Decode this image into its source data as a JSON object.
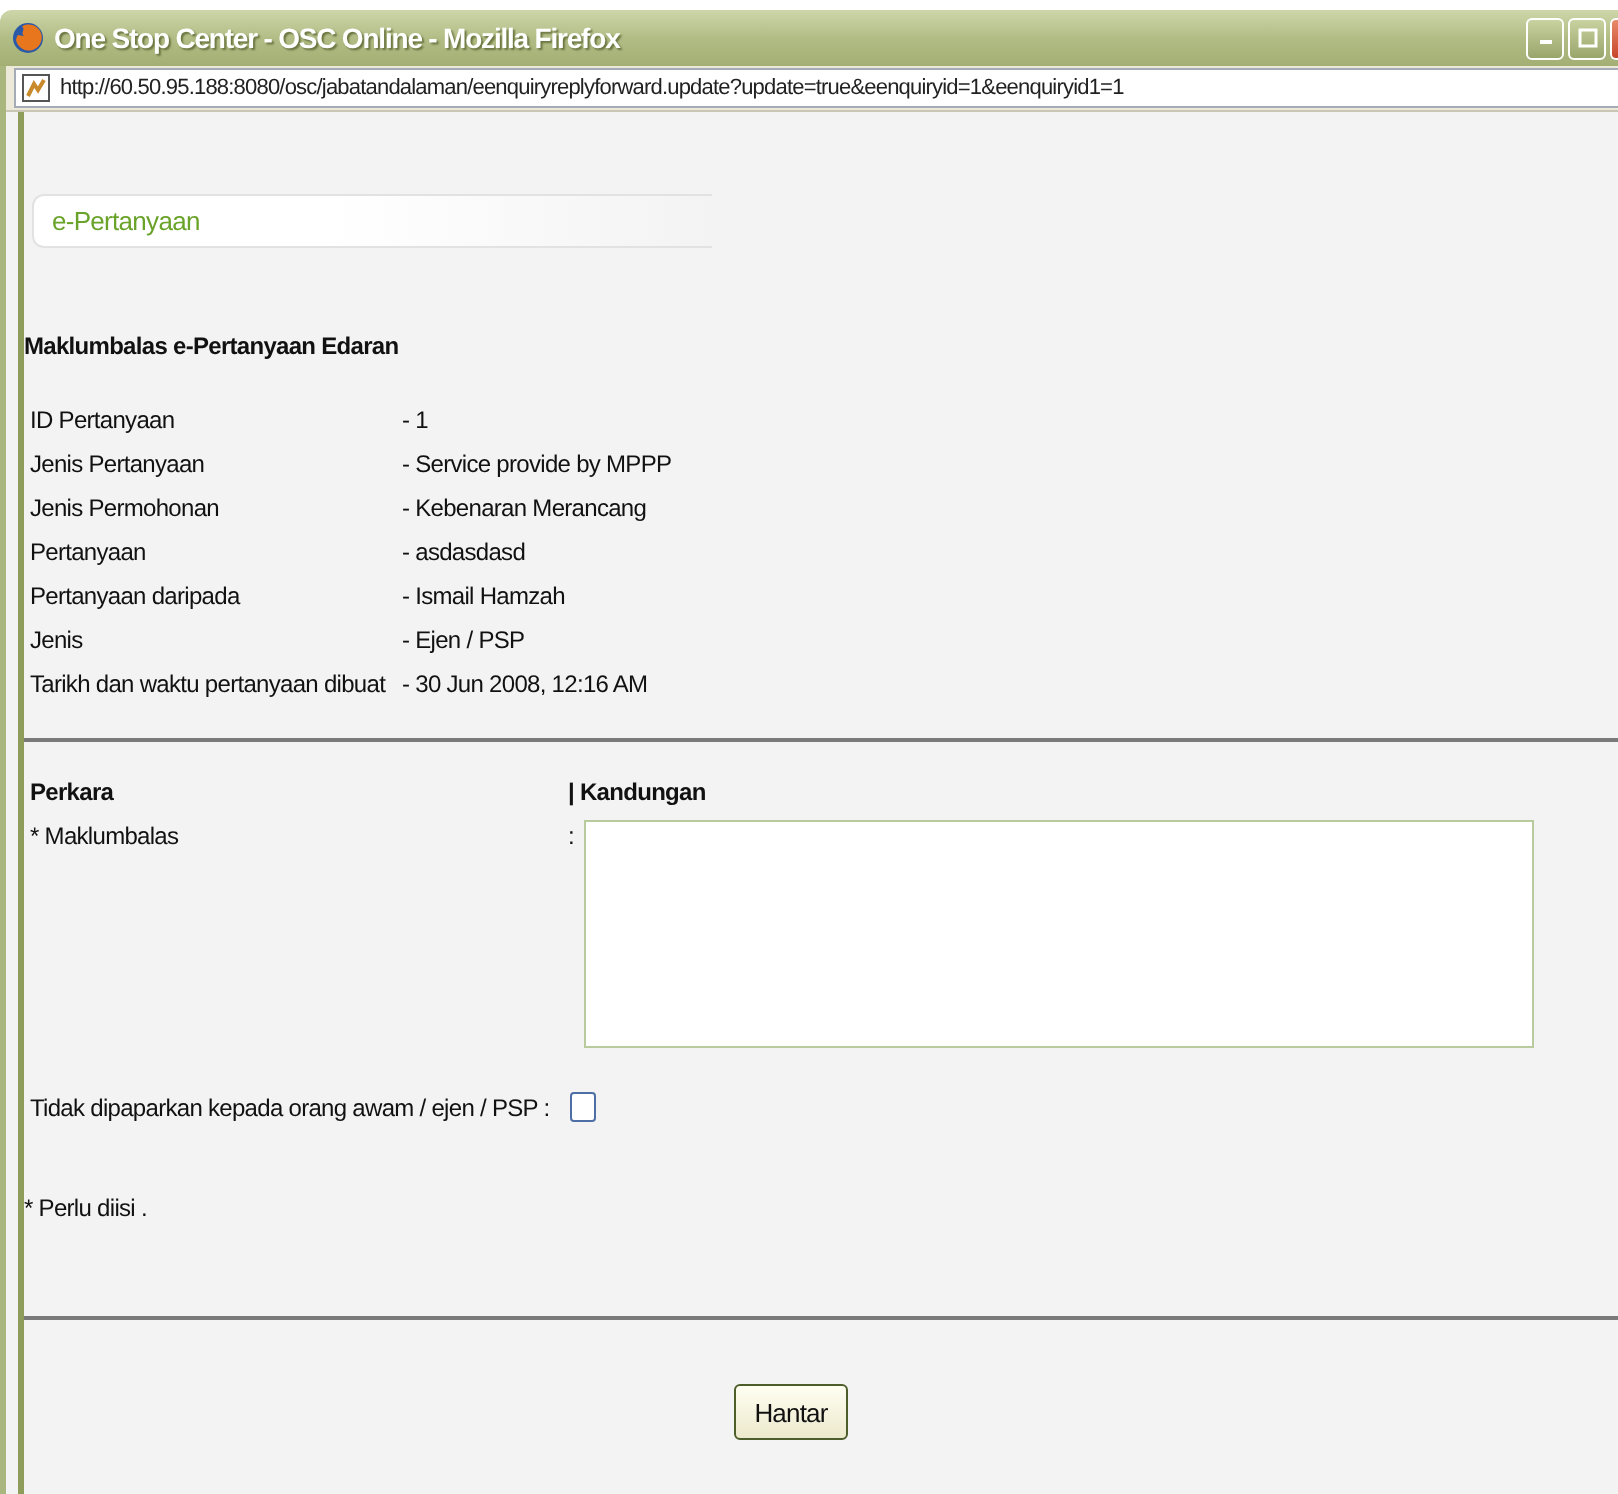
{
  "window": {
    "title": "One Stop Center - OSC Online - Mozilla Firefox"
  },
  "address_bar": {
    "url": "http://60.50.95.188:8080/osc/jabatandalaman/eenquiryreplyforward.update?update=true&eenquiryid=1&eenquiryid1=1"
  },
  "tab": {
    "label": "e-Pertanyaan"
  },
  "heading": "Maklumbalas e-Pertanyaan Edaran",
  "details": [
    {
      "label": "ID Pertanyaan",
      "value": "- 1"
    },
    {
      "label": "Jenis Pertanyaan",
      "value": "- Service provide by MPPP"
    },
    {
      "label": "Jenis Permohonan",
      "value": "- Kebenaran Merancang"
    },
    {
      "label": "Pertanyaan",
      "value": "- asdasdasd"
    },
    {
      "label": "Pertanyaan daripada",
      "value": "- Ismail Hamzah"
    },
    {
      "label": "Jenis",
      "value": "- Ejen / PSP"
    },
    {
      "label": "Tarikh dan waktu pertanyaan dibuat",
      "value": "- 30 Jun 2008, 12:16 AM"
    }
  ],
  "form": {
    "columns": [
      "Perkara",
      "| Kandungan"
    ],
    "fields": [
      {
        "kind": "textarea",
        "label": "* Maklumbalas",
        "separator": ":"
      },
      {
        "kind": "checkbox",
        "label": "Tidak dipaparkan kepada orang awam / ejen / PSP :",
        "checked": false
      }
    ]
  },
  "note": "* Perlu diisi .",
  "submit_button": "Hantar"
}
